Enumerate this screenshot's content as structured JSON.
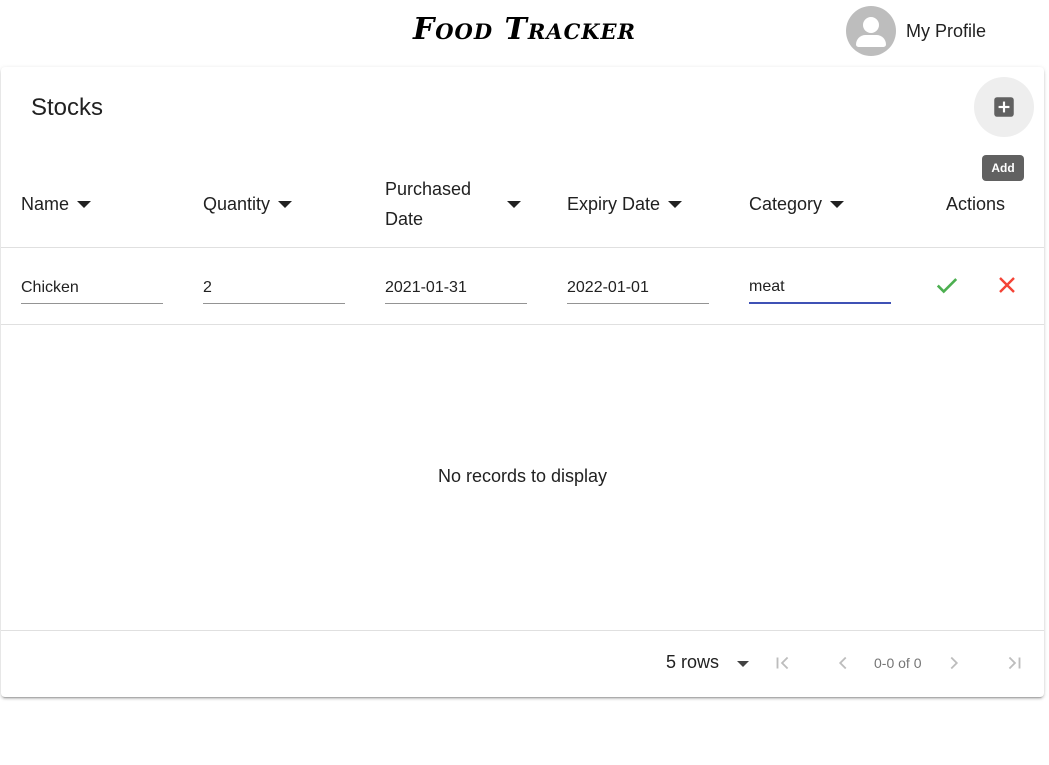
{
  "header": {
    "app_title": "Food Tracker",
    "profile_label": "My Profile",
    "avatar_icon": "account-circle-icon"
  },
  "table": {
    "title": "Stocks",
    "add_icon": "add-box-icon",
    "add_tooltip": "Add",
    "columns": [
      {
        "label": "Name"
      },
      {
        "label": "Quantity"
      },
      {
        "label_line1": "Purchased",
        "label_line2": "Date"
      },
      {
        "label": "Expiry Date"
      },
      {
        "label": "Category"
      },
      {
        "label": "Actions"
      }
    ],
    "edit_row": {
      "name": "Chicken",
      "quantity": "2",
      "purchased_date": "2021-01-31",
      "expiry_date": "2022-01-01",
      "category": "meat"
    },
    "actions": {
      "confirm_icon": "check-icon",
      "cancel_icon": "close-icon",
      "confirm_color": "#4caf50",
      "cancel_color": "#f44336"
    },
    "empty_message": "No records to display",
    "pagination": {
      "rows_per_page": "5 rows",
      "range": "0-0 of 0"
    }
  },
  "colors": {
    "focus_underline": "#3f51b5",
    "tooltip_bg": "#616161"
  }
}
